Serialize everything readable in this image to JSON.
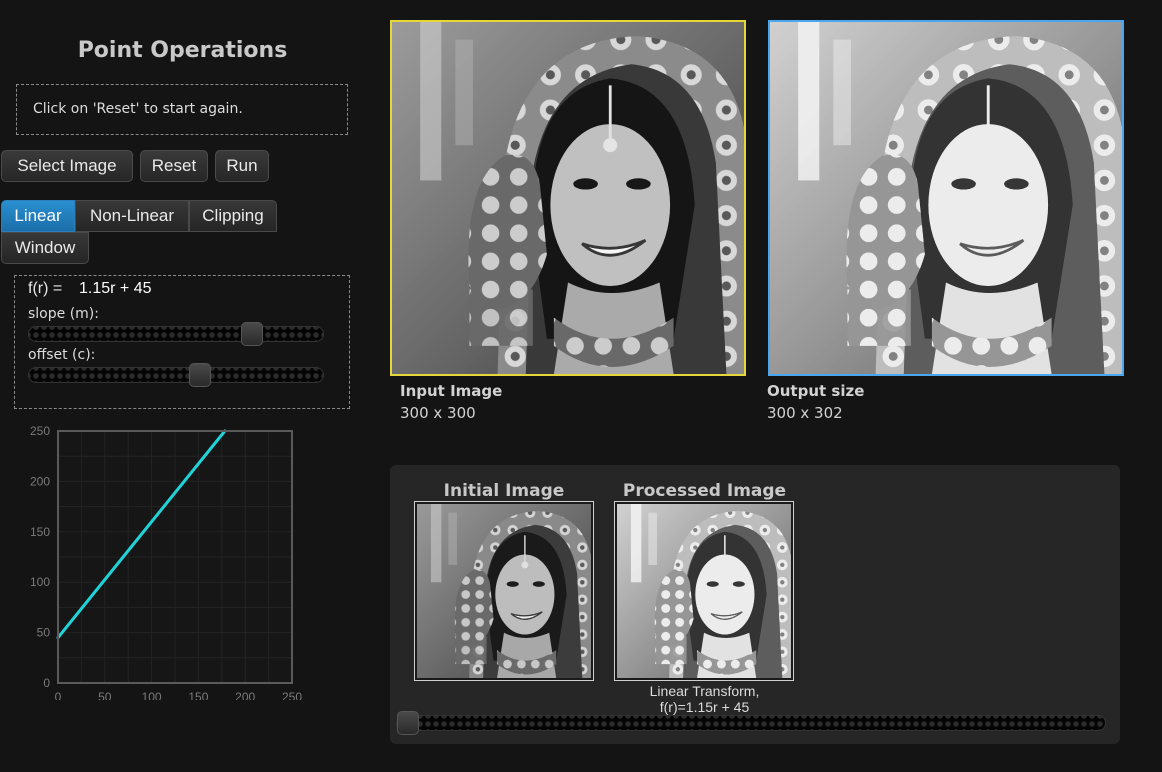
{
  "app": {
    "title": "Point Operations",
    "info_message": "Click on 'Reset' to start again."
  },
  "toolbar": {
    "select_label": "Select Image",
    "reset_label": "Reset",
    "run_label": "Run"
  },
  "tabs": [
    {
      "label": "Linear",
      "active": true
    },
    {
      "label": "Non-Linear",
      "active": false
    },
    {
      "label": "Clipping",
      "active": false
    },
    {
      "label": "Window",
      "active": false
    }
  ],
  "params": {
    "function_label": "f(r) =",
    "function_value": "1.15r + 45",
    "slope_label": "slope (m):",
    "offset_label": "offset (c):",
    "slope_position": 0.78,
    "offset_position": 0.59
  },
  "chart_data": {
    "type": "line",
    "x": [
      0,
      250
    ],
    "xlim": [
      0,
      250
    ],
    "ylim": [
      0,
      250
    ],
    "xticks": [
      0,
      50,
      100,
      150,
      200,
      250
    ],
    "yticks": [
      0,
      50,
      100,
      150,
      200,
      250
    ],
    "slope": 1.15,
    "offset": 45,
    "grid": true,
    "line_color": "#1fd3d8"
  },
  "images": {
    "input_label": "Input Image",
    "input_size": "300 x 300",
    "output_label": "Output size",
    "output_size": "300 x 302",
    "input_border_color": "#e5d73a",
    "output_border_color": "#4aa6ee"
  },
  "comparison": {
    "initial_title": "Initial Image",
    "processed_title": "Processed Image",
    "caption_line1": "Linear Transform,",
    "caption_line2": "f(r)=1.15r + 45",
    "slider_position": 0.0
  },
  "colors": {
    "accent": "#1b7fc4",
    "background": "#141414",
    "panel": "#262626"
  }
}
